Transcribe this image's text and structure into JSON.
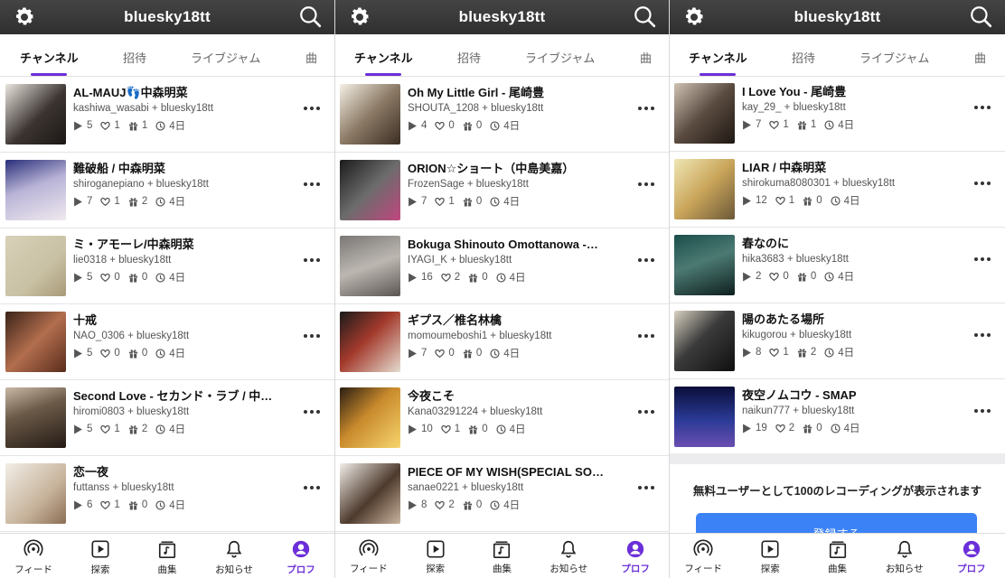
{
  "screens": [
    {
      "header_title": "bluesky18tt",
      "tabs": [
        "チャンネル",
        "招待",
        "ライブジャム",
        "曲"
      ],
      "items": [
        {
          "song": "AL-MAUJ👣中森明菜",
          "artist": "kashiwa_wasabi + bluesky18tt",
          "plays": "5",
          "likes": "1",
          "gifts": "1",
          "time": "4日"
        },
        {
          "song": "難破船 / 中森明菜",
          "artist": "shiroganepiano + bluesky18tt",
          "plays": "7",
          "likes": "1",
          "gifts": "2",
          "time": "4日"
        },
        {
          "song": "ミ・アモーレ/中森明菜",
          "artist": "lie0318 + bluesky18tt",
          "plays": "5",
          "likes": "0",
          "gifts": "0",
          "time": "4日"
        },
        {
          "song": "十戒",
          "artist": "NAO_0306 + bluesky18tt",
          "plays": "5",
          "likes": "0",
          "gifts": "0",
          "time": "4日"
        },
        {
          "song": "Second Love - セカンド・ラブ / 中…",
          "artist": "hiromi0803 + bluesky18tt",
          "plays": "5",
          "likes": "1",
          "gifts": "2",
          "time": "4日"
        },
        {
          "song": "恋一夜",
          "artist": "futtanss + bluesky18tt",
          "plays": "6",
          "likes": "1",
          "gifts": "0",
          "time": "4日"
        }
      ]
    },
    {
      "header_title": "bluesky18tt",
      "tabs": [
        "チャンネル",
        "招待",
        "ライブジャム",
        "曲"
      ],
      "items": [
        {
          "song": "Oh My Little Girl - 尾崎豊",
          "artist": "SHOUTA_1208 + bluesky18tt",
          "plays": "4",
          "likes": "0",
          "gifts": "0",
          "time": "4日"
        },
        {
          "song": "ORION☆ショート（中島美嘉）",
          "artist": "FrozenSage + bluesky18tt",
          "plays": "7",
          "likes": "1",
          "gifts": "0",
          "time": "4日"
        },
        {
          "song": "Bokuga Shinouto Omottanowa -…",
          "artist": "IYAGI_K + bluesky18tt",
          "plays": "16",
          "likes": "2",
          "gifts": "0",
          "time": "4日"
        },
        {
          "song": "ギプス／椎名林檎",
          "artist": "momoumeboshi1 + bluesky18tt",
          "plays": "7",
          "likes": "0",
          "gifts": "0",
          "time": "4日"
        },
        {
          "song": "今夜こそ",
          "artist": "Kana03291224 + bluesky18tt",
          "plays": "10",
          "likes": "1",
          "gifts": "0",
          "time": "4日"
        },
        {
          "song": "PIECE OF MY WISH(SPECIAL SO…",
          "artist": "sanae0221 + bluesky18tt",
          "plays": "8",
          "likes": "2",
          "gifts": "0",
          "time": "4日"
        }
      ]
    },
    {
      "header_title": "bluesky18tt",
      "tabs": [
        "チャンネル",
        "招待",
        "ライブジャム",
        "曲"
      ],
      "items": [
        {
          "song": "I Love You - 尾崎豊",
          "artist": "kay_29_ + bluesky18tt",
          "plays": "7",
          "likes": "1",
          "gifts": "1",
          "time": "4日"
        },
        {
          "song": "LIAR / 中森明菜",
          "artist": "shirokuma8080301 + bluesky18tt",
          "plays": "12",
          "likes": "1",
          "gifts": "0",
          "time": "4日"
        },
        {
          "song": "春なのに",
          "artist": "hika3683 + bluesky18tt",
          "plays": "2",
          "likes": "0",
          "gifts": "0",
          "time": "4日"
        },
        {
          "song": "陽のあたる場所",
          "artist": "kikugorou + bluesky18tt",
          "plays": "8",
          "likes": "1",
          "gifts": "2",
          "time": "4日"
        },
        {
          "song": "夜空ノムコウ - SMAP",
          "artist": "naikun777 + bluesky18tt",
          "plays": "19",
          "likes": "2",
          "gifts": "0",
          "time": "4日"
        }
      ],
      "notice": "無料ユーザーとして100のレコーディングが表示されます",
      "register_button": "登録する"
    }
  ],
  "bottom_nav": [
    "フィード",
    "探索",
    "曲集",
    "お知らせ",
    "プロフ"
  ],
  "icons": {
    "settings": "gear-icon",
    "search": "search-icon",
    "play": "play-icon",
    "like": "heart-icon",
    "gift": "gift-icon",
    "time": "clock-icon",
    "more": "more-icon"
  },
  "colors": {
    "accent": "#6b2fd9",
    "header_bg": "#3a3a3a",
    "button": "#3b82f6"
  }
}
